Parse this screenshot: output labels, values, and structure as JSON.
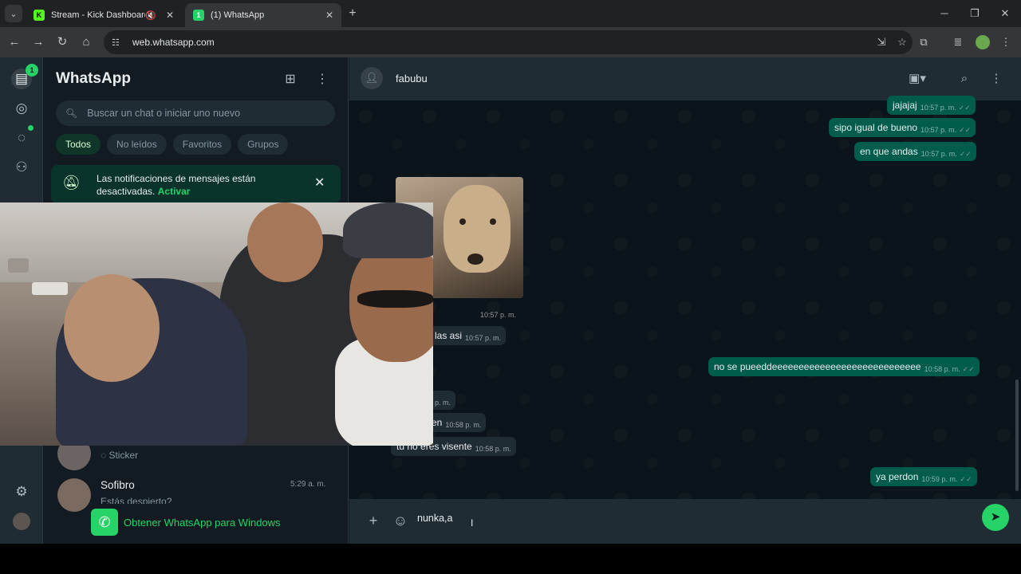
{
  "browser": {
    "tabs": [
      {
        "title": "Stream - Kick Dashboard",
        "favicon": "K"
      },
      {
        "title": "(1) WhatsApp",
        "favicon": "1"
      }
    ],
    "url": "web.whatsapp.com"
  },
  "rail": {
    "badge": "1"
  },
  "sidebar": {
    "title": "WhatsApp",
    "search_placeholder": "Buscar un chat o iniciar uno nuevo",
    "filters": [
      "Todos",
      "No leídos",
      "Favoritos",
      "Grupos"
    ],
    "notice": {
      "text": "Las notificaciones de mensajes están desactivadas.",
      "link": "Activar"
    },
    "chats": [
      {
        "name": "",
        "preview": "Sticker",
        "time": ""
      },
      {
        "name": "Sofibro",
        "preview": "Estás despierto?",
        "time": "5:29 a. m."
      }
    ],
    "get_app": "Obtener WhatsApp para Windows"
  },
  "chat": {
    "contact_name": "fabubu",
    "messages": [
      {
        "text": "jajajaj",
        "time": "10:57 p. m.",
        "direction": "out"
      },
      {
        "text": "sipo igual de bueno",
        "time": "10:57 p. m.",
        "direction": "out"
      },
      {
        "text": "en que andas",
        "time": "10:57 p. m.",
        "direction": "out"
      },
      {
        "text": "",
        "time": "10:57 p. m.",
        "direction": "in",
        "type": "image"
      },
      {
        "text": "las asi",
        "time": "10:57 p. m.",
        "direction": "in"
      },
      {
        "text": "no se pueeddeeeeeeeeeeeeeeeeeeeeeeeeeeee",
        "time": "10:58 p. m.",
        "direction": "out"
      },
      {
        "text": "",
        "time": "p. m.",
        "direction": "in"
      },
      {
        "text": "en",
        "time": "10:58 p. m.",
        "direction": "in"
      },
      {
        "text": "tu no eres visente",
        "time": "10:58 p. m.",
        "direction": "in"
      },
      {
        "text": "ya perdon",
        "time": "10:59 p. m.",
        "direction": "out"
      }
    ],
    "composer_value": "nunka,a"
  },
  "colors": {
    "accent": "#25d366",
    "outgoing_bubble": "#005c4b",
    "incoming_bubble": "#202c33",
    "background": "#0b141a",
    "panel": "#202c33"
  },
  "icons": [
    "chats-icon",
    "status-icon",
    "channels-icon",
    "communities-icon",
    "settings-icon",
    "new-chat-icon",
    "menu-icon",
    "search-icon",
    "video-call-icon",
    "attach-icon",
    "sticker-icon",
    "send-icon",
    "bell-off-icon",
    "close-icon"
  ]
}
